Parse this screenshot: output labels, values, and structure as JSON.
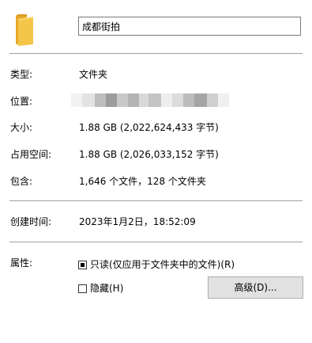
{
  "folder": {
    "icon": "folder-icon",
    "name": "成都街拍"
  },
  "properties": [
    {
      "label": "类型:",
      "value": "文件夹"
    },
    {
      "label": "位置:",
      "value": ""
    },
    {
      "label": "大小:",
      "value": "1.88 GB (2,022,624,433 字节)"
    },
    {
      "label": "占用空间:",
      "value": "1.88 GB (2,026,033,152 字节)"
    },
    {
      "label": "包含:",
      "value": "1,646 个文件，128 个文件夹"
    },
    {
      "label": "创建时间:",
      "value": "2023年1月2日，18:52:09"
    }
  ],
  "attributes": {
    "label": "属性:",
    "readonly_label": "只读(仅应用于文件夹中的文件)(R)",
    "readonly_state": "indeterminate",
    "hidden_label": "隐藏(H)",
    "hidden_checked": false,
    "advanced_button": "高级(D)..."
  },
  "colors": {
    "folder_body": "#f5c54a",
    "folder_back": "#e6a82a"
  }
}
